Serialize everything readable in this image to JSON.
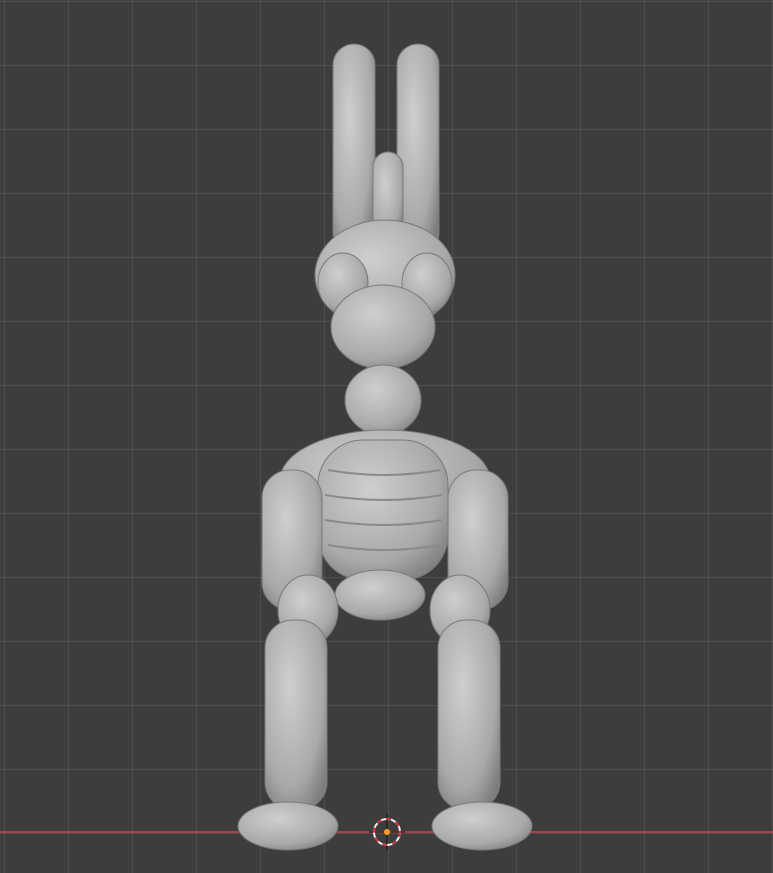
{
  "viewport": {
    "background_color": "#3d3d3d",
    "x_axis_color": "#a5424c",
    "model_color": "#b4b4b4",
    "cursor_color": "#c8323c",
    "origin_color": "#f5a020",
    "icons": {
      "cursor": "3d-cursor-icon",
      "origin": "origin-dot-icon"
    }
  }
}
